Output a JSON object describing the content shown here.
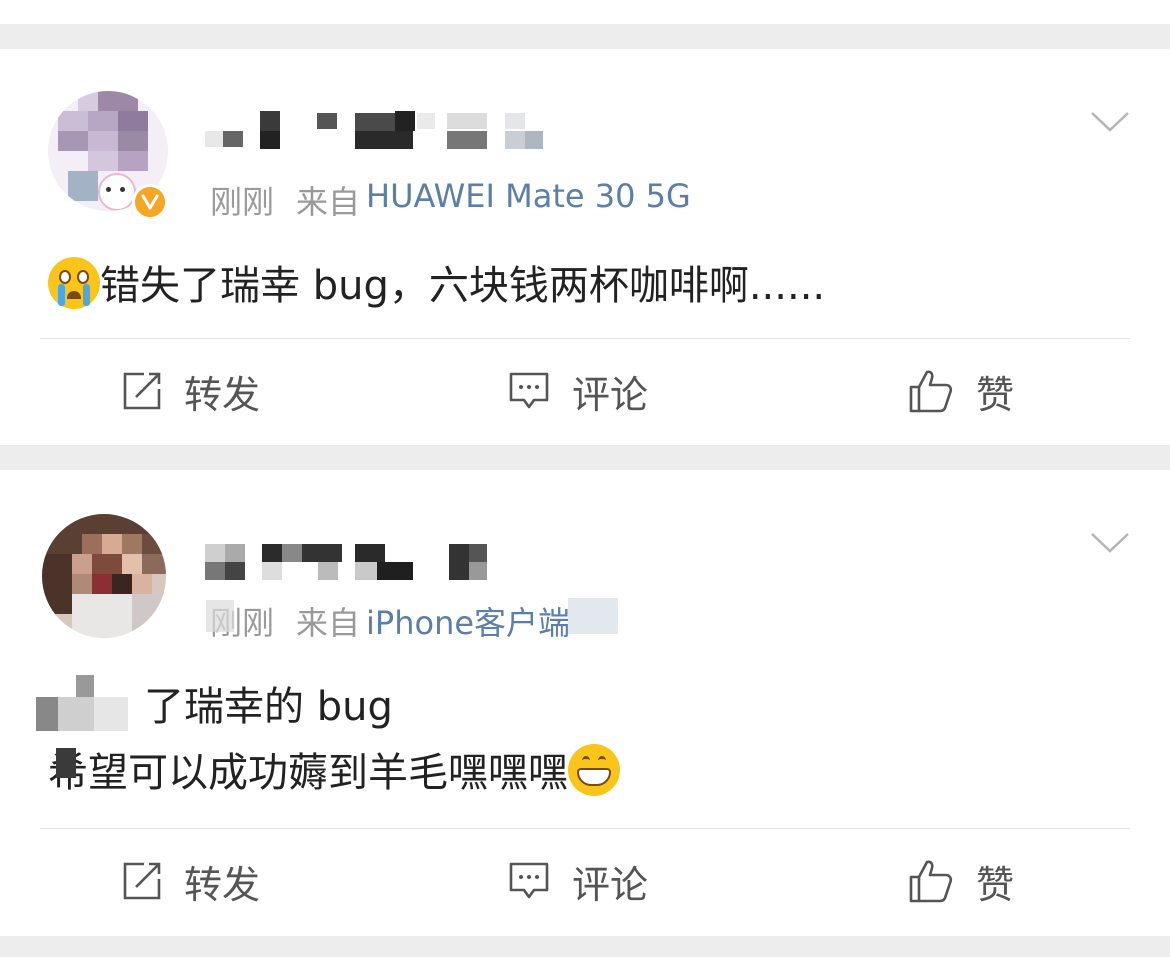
{
  "posts": [
    {
      "time": "刚刚",
      "source_prefix": "来自",
      "device": "HUAWEI Mate 30 5G",
      "content_lines": [
        "错失了瑞幸 bug，六块钱两杯咖啡啊......"
      ],
      "emoji_icon": "crying-face-icon",
      "verified_badge": true,
      "actions": {
        "repost": "转发",
        "comment": "评论",
        "like": "赞"
      }
    },
    {
      "time": "刚刚",
      "source_prefix": "来自",
      "device": "iPhone客户端",
      "content_lines": [
        "了瑞幸的 bug",
        "希望可以成功薅到羊毛嘿嘿嘿"
      ],
      "emoji_icon": "grinning-face-icon",
      "actions": {
        "repost": "转发",
        "comment": "评论",
        "like": "赞"
      }
    }
  ],
  "colors": {
    "device_link": "#5b7fa8",
    "meta_gray": "#9a9a9a",
    "badge": "#f5a623",
    "background": "#ededed"
  },
  "icons": [
    "chevron-down-icon",
    "repost-icon",
    "comment-icon",
    "like-icon",
    "verified-badge-icon"
  ]
}
